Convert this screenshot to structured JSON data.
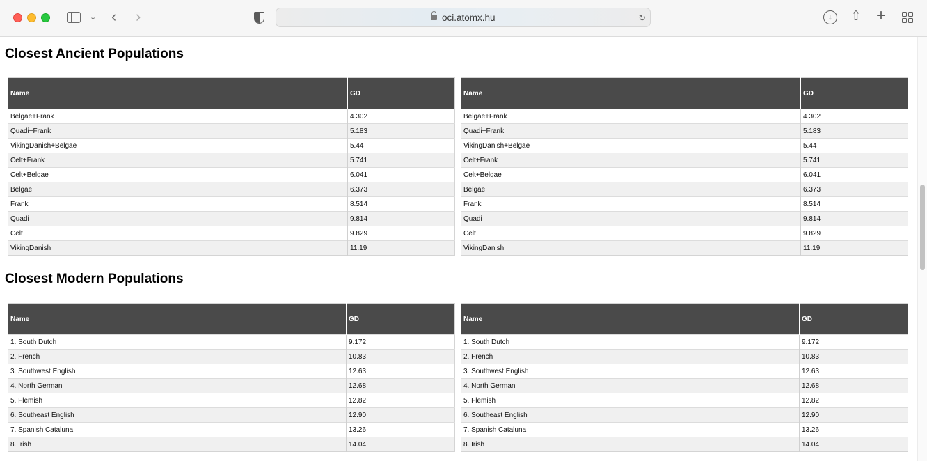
{
  "browser": {
    "url": "oci.atomx.hu"
  },
  "icons": {
    "sidebar": "sidebar-icon",
    "tab_overview_chevron": "chevron-down-icon",
    "back": "chevron-left-icon",
    "forward": "chevron-right-icon",
    "privacy": "shield-icon",
    "lock": "lock-icon",
    "reload": "reload-icon",
    "download": "download-icon",
    "share": "share-icon",
    "new_tab": "plus-icon",
    "tab_overview": "grid-icon"
  },
  "colors": {
    "table_header_bg": "#4a4a4a",
    "table_header_text": "#ffffff",
    "row_alt_bg": "#f0f0f0"
  },
  "ancient": {
    "title": "Closest Ancient Populations",
    "columns": [
      "Name",
      "GD"
    ],
    "rows": [
      [
        "Belgae+Frank",
        "4.302"
      ],
      [
        "Quadi+Frank",
        "5.183"
      ],
      [
        "VikingDanish+Belgae",
        "5.44"
      ],
      [
        "Celt+Frank",
        "5.741"
      ],
      [
        "Celt+Belgae",
        "6.041"
      ],
      [
        "Belgae",
        "6.373"
      ],
      [
        "Frank",
        "8.514"
      ],
      [
        "Quadi",
        "9.814"
      ],
      [
        "Celt",
        "9.829"
      ],
      [
        "VikingDanish",
        "11.19"
      ]
    ]
  },
  "modern": {
    "title": "Closest Modern Populations",
    "columns": [
      "Name",
      "GD"
    ],
    "rows": [
      [
        "1. South Dutch",
        "9.172"
      ],
      [
        "2. French",
        "10.83"
      ],
      [
        "3. Southwest English",
        "12.63"
      ],
      [
        "4. North German",
        "12.68"
      ],
      [
        "5. Flemish",
        "12.82"
      ],
      [
        "6. Southeast English",
        "12.90"
      ],
      [
        "7. Spanish Cataluna",
        "13.26"
      ],
      [
        "8. Irish",
        "14.04"
      ]
    ]
  }
}
